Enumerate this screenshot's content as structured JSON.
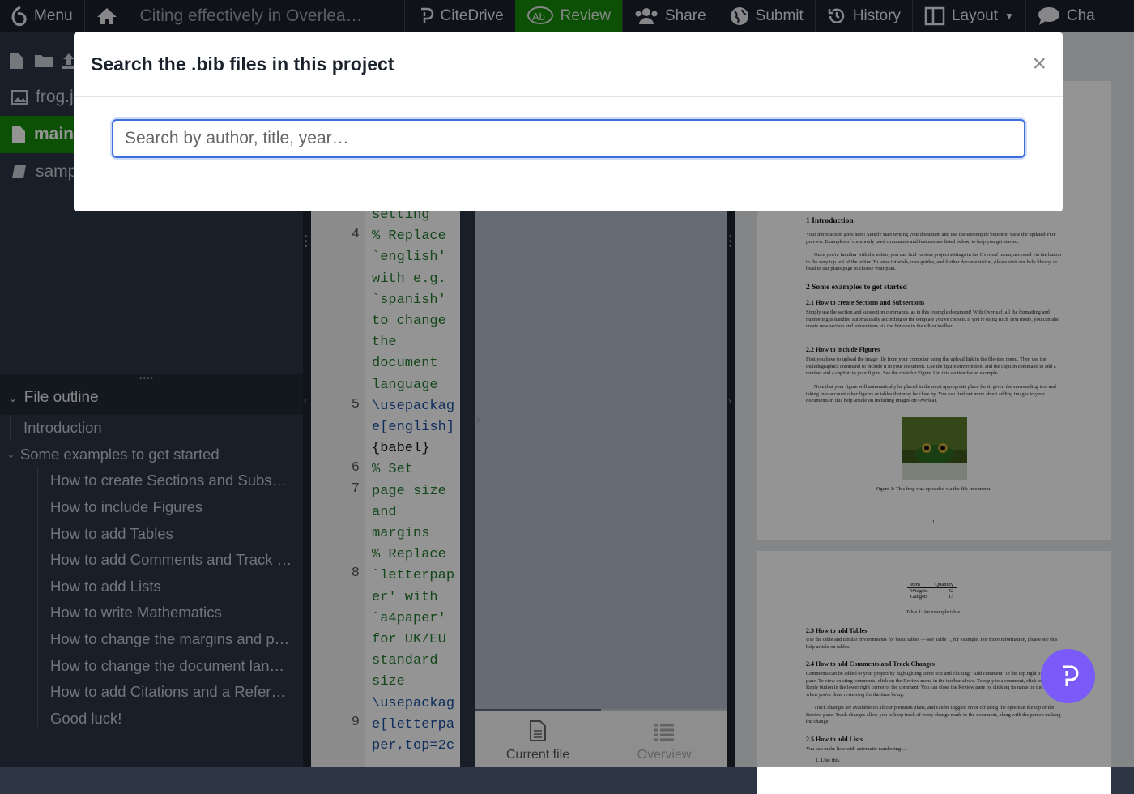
{
  "toolbar": {
    "menu_label": "Menu",
    "project_title": "Citing effectively in Overlea…",
    "citedrive_label": "CiteDrive",
    "review_label": "Review",
    "share_label": "Share",
    "submit_label": "Submit",
    "history_label": "History",
    "layout_label": "Layout",
    "chat_label": "Cha"
  },
  "filetree": {
    "items": [
      {
        "label": "frog.j"
      },
      {
        "label": "main."
      },
      {
        "label": "samp"
      }
    ]
  },
  "outline": {
    "title": "File outline",
    "items": [
      {
        "label": "Introduction"
      },
      {
        "label": "Some examples to get started"
      },
      {
        "label": "How to create Sections and Subs…"
      },
      {
        "label": "How to include Figures"
      },
      {
        "label": "How to add Tables"
      },
      {
        "label": "How to add Comments and Track …"
      },
      {
        "label": "How to add Lists"
      },
      {
        "label": "How to write Mathematics"
      },
      {
        "label": "How to change the margins and p…"
      },
      {
        "label": "How to change the document lan…"
      },
      {
        "label": "How to add Citations and a Refer…"
      },
      {
        "label": "Good luck!"
      }
    ]
  },
  "editor": {
    "line_numbers": [
      "4",
      "5",
      "6",
      "7",
      "8",
      "9"
    ],
    "lines": [
      "setting",
      "% Replace",
      "`english'",
      "with e.g.",
      "`spanish'",
      "to change",
      "the",
      "document",
      "language",
      "\\usepackag",
      "e[english]",
      "{babel}",
      "% Set",
      "page size",
      "and",
      "margins",
      "% Replace",
      "`letterpap",
      "er' with",
      "`a4paper'",
      "for UK/EU",
      "standard",
      "size",
      "\\usepackag",
      "e[letterpa",
      "per,top=2c"
    ]
  },
  "review": {
    "tab_current": "Current file",
    "tab_overview": "Overview"
  },
  "pdf": {
    "h1": "1   Introduction",
    "p1": "Your introduction goes here! Simply start writing your document and use the Recompile button to view the updated PDF preview. Examples of commonly used commands and features are listed below, to help you get started.",
    "p1b": "Once you're familiar with the editor, you can find various project settings in the Overleaf menu, accessed via the button in the very top left of the editor. To view tutorials, user guides, and further documentation, please visit our help library, or head to our plans page to choose your plan.",
    "h2": "2   Some examples to get started",
    "h21": "2.1   How to create Sections and Subsections",
    "p21": "Simply use the section and subsection commands, as in this example document! With Overleaf, all the formatting and numbering is handled automatically according to the template you've chosen. If you're using Rich Text mode, you can also create new section and subsections via the buttons in the editor toolbar.",
    "h22": "2.2   How to include Figures",
    "p22": "First you have to upload the image file from your computer using the upload link in the file-tree menu. Then use the includegraphics command to include it in your document. Use the figure environment and the caption command to add a number and a caption to your figure. See the code for Figure 1 in this section for an example.",
    "p22b": "Note that your figure will automatically be placed in the most appropriate place for it, given the surrounding text and taking into account other figures or tables that may be close by. You can find out more about adding images to your documents in this help article on including images on Overleaf.",
    "fig_caption": "Figure 1: This frog was uploaded via the file-tree menu.",
    "page_number": "1",
    "table_head_item": "Item",
    "table_head_qty": "Quantity",
    "table_rows": [
      [
        "Widgets",
        "42"
      ],
      [
        "Gadgets",
        "13"
      ]
    ],
    "table_caption": "Table 1: An example table.",
    "h23": "2.3   How to add Tables",
    "p23": "Use the table and tabular environments for basic tables — see Table 1, for example. For more information, please see this help article on tables.",
    "h24": "2.4   How to add Comments and Track Changes",
    "p24": "Comments can be added to your project by highlighting some text and clicking \"Add comment\" in the top right of the editor pane. To view existing comments, click on the Review menu in the toolbar above. To reply to a comment, click on the Reply button in the lower right corner of the comment. You can close the Review pane by clicking its name on the toolbar when you're done reviewing for the time being.",
    "p24b": "Track changes are available on all our premium plans, and can be toggled on or off using the option at the top of the Review pane. Track changes allow you to keep track of every change made to the document, along with the person making the change.",
    "h25": "2.5   How to add Lists",
    "p25": "You can make lists with automatic numbering …",
    "p25b": "1. Like this,"
  },
  "modal": {
    "title": "Search the .bib files in this project",
    "close_label": "×",
    "search_placeholder": "Search by author, title, year…",
    "search_value": ""
  },
  "colors": {
    "accent_green": "#138a07",
    "modal_focus": "#3b6ede",
    "fab": "#7a5af8"
  }
}
